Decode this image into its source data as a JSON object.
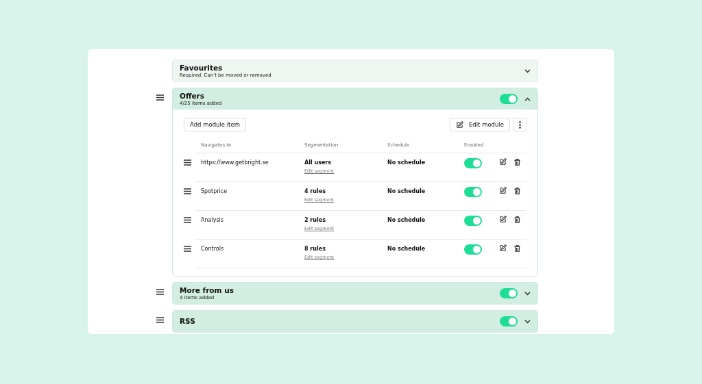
{
  "modules": [
    {
      "kind": "required",
      "title": "Favourites",
      "subtitle": "Required. Can't be moved or removed",
      "expanded": false
    },
    {
      "kind": "module",
      "title": "Offers",
      "subtitle": "4/25 items added",
      "on": true,
      "expanded": true,
      "add_button": "Add module item",
      "edit_button": "Edit module",
      "columns": [
        "Navigates to",
        "Segmentation",
        "Schedule",
        "Enabled"
      ],
      "rows": [
        {
          "target": "https://www.getbright.se",
          "segment": "All users",
          "segment_link": "Edit segment",
          "schedule": "No schedule",
          "on": true
        },
        {
          "target": "Spotprice",
          "segment": "4 rules",
          "segment_link": "Edit segment",
          "schedule": "No schedule",
          "on": true
        },
        {
          "target": "Analysis",
          "segment": "2 rules",
          "segment_link": "Edit segment",
          "schedule": "No schedule",
          "on": true
        },
        {
          "target": "Controls",
          "segment": "8 rules",
          "segment_link": "Edit segment",
          "schedule": "No schedule",
          "on": true
        }
      ]
    },
    {
      "kind": "module",
      "title": "More from us",
      "subtitle": "4 items added",
      "on": true,
      "expanded": false
    },
    {
      "kind": "module",
      "title": "RSS",
      "on": true,
      "expanded": false
    }
  ]
}
